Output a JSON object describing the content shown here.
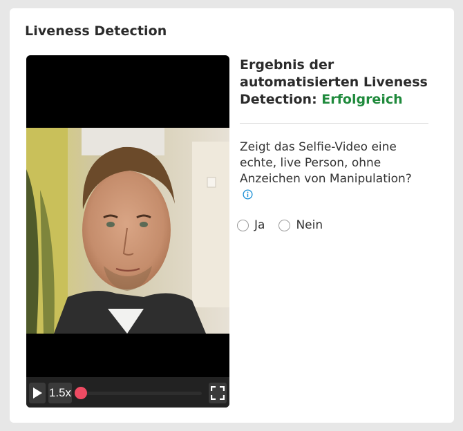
{
  "card": {
    "title": "Liveness Detection"
  },
  "video": {
    "speed_label": "1.5x",
    "progress": 0.0,
    "play_icon": "play-icon",
    "fullscreen_icon": "fullscreen-icon",
    "accent_color": "#ee4b63"
  },
  "result": {
    "title_prefix": "Ergebnis der automatisierten Liveness Detection: ",
    "status": "Erfolgreich",
    "status_color": "#1f8a3c"
  },
  "question": {
    "text": "Zeigt das Selfie-Video eine echte, live Person, ohne Anzeichen von Manipulation?",
    "info_icon": "info-icon"
  },
  "answer_options": {
    "yes_label": "Ja",
    "no_label": "Nein",
    "selected": null
  }
}
